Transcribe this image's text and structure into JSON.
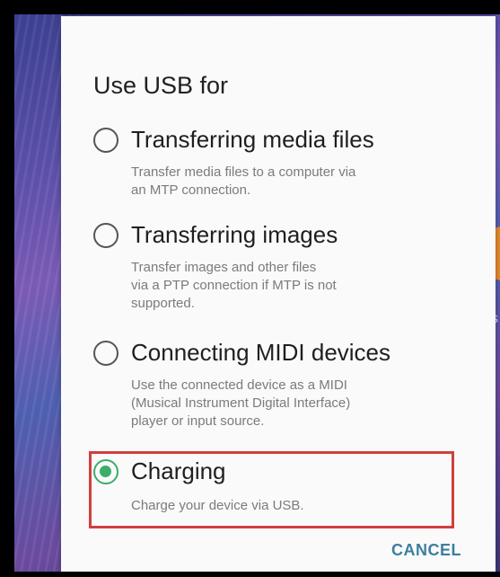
{
  "dialog": {
    "title": "Use USB for",
    "options": [
      {
        "label": "Transferring media files",
        "description": "Transfer media files to a computer via\nan MTP connection.",
        "selected": false
      },
      {
        "label": "Transferring images",
        "description": "Transfer images and other files\nvia a PTP connection if MTP is not\nsupported.",
        "selected": false
      },
      {
        "label": "Connecting MIDI devices",
        "description": "Use the connected device as a MIDI\n(Musical Instrument Digital Interface)\nplayer or input source.",
        "selected": false
      },
      {
        "label": "Charging",
        "description": "Charge your device via USB.",
        "selected": true
      }
    ],
    "cancel_label": "CANCEL"
  },
  "background": {
    "partial_label": "ts"
  },
  "colors": {
    "accent_green": "#3bae6a",
    "highlight_red": "#d0403d",
    "button_blue": "#3b7fa0"
  }
}
